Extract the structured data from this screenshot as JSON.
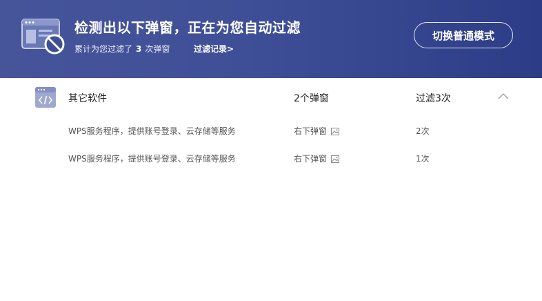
{
  "header": {
    "title": "检测出以下弹窗，正在为您自动过滤",
    "subtitle_prefix": "累计为您过滤了",
    "filtered_count": "3",
    "subtitle_suffix": "次弹窗",
    "filter_log_link": "过滤记录>",
    "switch_mode_button": "切换普通模式",
    "icon": "blocked-window-icon"
  },
  "group": {
    "name": "其它软件",
    "popup_count": "2个弹窗",
    "filter_count": "过滤3次",
    "icon": "code-window-icon",
    "toggle_icon": "chevron-up-icon"
  },
  "items": [
    {
      "description": "WPS服务程序，提供账号登录、云存储等服务",
      "position": "右下弹窗",
      "times": "2次",
      "preview_icon": "image-icon"
    },
    {
      "description": "WPS服务程序，提供账号登录、云存储等服务",
      "position": "右下弹窗",
      "times": "1次",
      "preview_icon": "image-icon"
    }
  ],
  "colors": {
    "header_start": "#46559a",
    "header_end": "#2c3c86",
    "group_icon": "#9fa8cf"
  }
}
